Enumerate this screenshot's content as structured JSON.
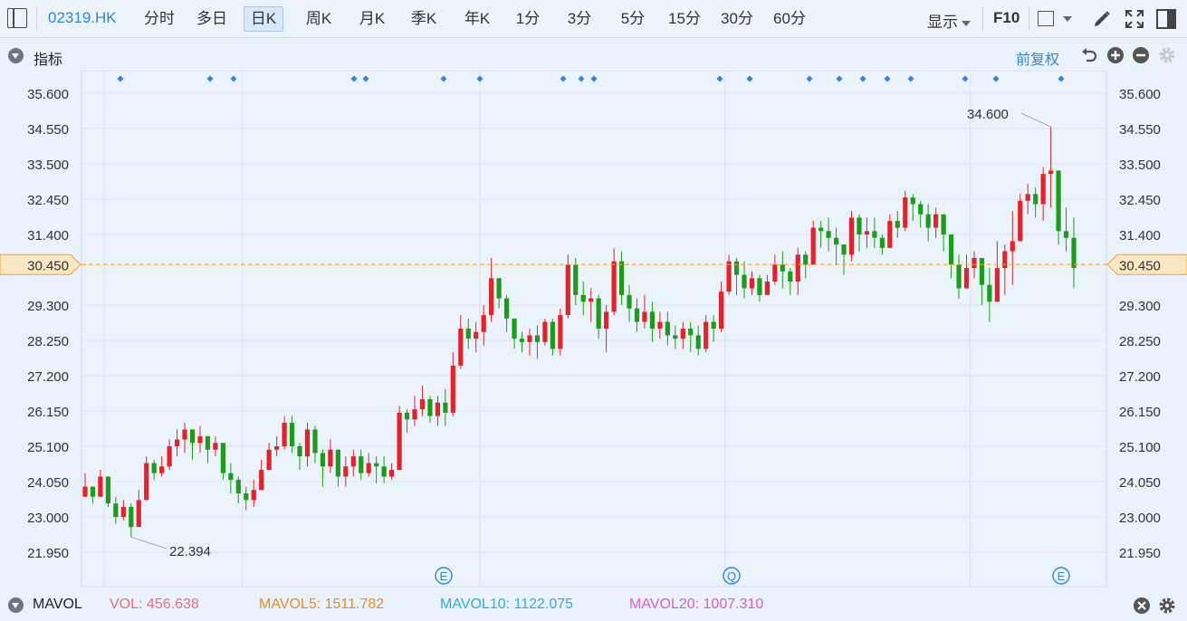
{
  "toolbar": {
    "symbol": "02319.HK",
    "periods": [
      "分时",
      "多日",
      "日K",
      "周K",
      "月K",
      "季K",
      "年K",
      "1分",
      "3分",
      "5分",
      "15分",
      "30分",
      "60分"
    ],
    "active_period": "日K",
    "display_label": "显示",
    "f10_label": "F10"
  },
  "indicator": {
    "title": "指标",
    "adjust_label": "前复权"
  },
  "price_axis": {
    "ticks": [
      "35.600",
      "34.550",
      "33.500",
      "32.450",
      "31.400",
      "30.450",
      "29.300",
      "28.250",
      "27.200",
      "26.150",
      "25.100",
      "24.050",
      "23.000",
      "21.950"
    ],
    "current_price": "30.450",
    "high_label": "34.600",
    "low_label": "22.394"
  },
  "event_markers": [
    "E",
    "Q",
    "E"
  ],
  "colors": {
    "up": "#e8202a",
    "down": "#1a9e1a",
    "price_line": "#f0a030",
    "grid": "#d6e4f0",
    "accent": "#2e86de"
  },
  "mavol": {
    "title": "MAVOL",
    "vol_label": "VOL:",
    "vol_value": "456.638",
    "vol_color": "#f06c75",
    "ma5_label": "MAVOL5:",
    "ma5_value": "1511.782",
    "ma5_color": "#ee8a22",
    "ma10_label": "MAVOL10:",
    "ma10_value": "1122.075",
    "ma10_color": "#2ab0d8",
    "ma20_label": "MAVOL20:",
    "ma20_value": "1007.310",
    "ma20_color": "#d461c8"
  },
  "chart_data": {
    "type": "candlestick",
    "ylim": [
      21.6,
      36.0
    ],
    "closes": [
      23.9,
      23.6,
      24.2,
      23.4,
      23.0,
      23.3,
      22.7,
      23.5,
      24.6,
      24.3,
      24.5,
      25.1,
      25.3,
      25.6,
      25.2,
      25.4,
      25.0,
      25.2,
      24.3,
      24.1,
      23.7,
      23.5,
      23.8,
      24.4,
      25.0,
      25.1,
      25.8,
      25.1,
      24.8,
      25.6,
      24.9,
      24.5,
      25.0,
      24.2,
      24.5,
      24.8,
      24.3,
      24.6,
      24.5,
      24.2,
      24.4,
      26.1,
      25.9,
      26.2,
      26.5,
      26.0,
      26.4,
      26.1,
      27.5,
      28.6,
      28.3,
      28.5,
      29.0,
      30.1,
      29.5,
      28.9,
      28.3,
      28.2,
      28.4,
      28.2,
      28.8,
      28.0,
      29.0,
      30.5,
      29.6,
      29.4,
      29.5,
      28.6,
      29.1,
      30.6,
      29.6,
      29.2,
      28.8,
      29.1,
      28.6,
      28.8,
      28.4,
      28.3,
      28.6,
      28.4,
      28.0,
      28.8,
      28.6,
      29.7,
      30.6,
      30.2,
      29.8,
      30.1,
      29.6,
      30.0,
      30.5,
      30.3,
      30.0,
      30.8,
      30.5,
      31.6,
      31.5,
      31.3,
      31.1,
      30.8,
      31.9,
      31.4,
      31.5,
      31.3,
      31.0,
      31.8,
      31.6,
      32.5,
      32.3,
      32.0,
      31.6,
      32.0,
      31.4,
      30.5,
      29.8,
      30.4,
      30.7,
      29.9,
      29.4,
      30.4,
      30.9,
      31.2,
      32.4,
      32.6,
      32.3,
      33.2,
      33.3,
      31.5,
      31.3,
      30.4
    ],
    "highs": [
      24.3,
      23.8,
      24.4,
      24.0,
      23.6,
      23.5,
      23.4,
      23.8,
      24.8,
      24.7,
      24.8,
      25.3,
      25.6,
      25.8,
      25.5,
      25.7,
      25.3,
      25.4,
      25.0,
      24.6,
      24.2,
      23.9,
      24.1,
      24.7,
      25.2,
      25.4,
      26.0,
      26.0,
      25.2,
      25.8,
      25.7,
      25.0,
      25.3,
      24.8,
      24.8,
      25.0,
      25.0,
      24.9,
      24.8,
      24.8,
      24.6,
      26.3,
      26.2,
      26.6,
      26.9,
      26.6,
      26.6,
      26.8,
      27.9,
      29.0,
      28.9,
      28.8,
      29.3,
      30.7,
      30.0,
      29.6,
      28.8,
      28.5,
      28.6,
      28.7,
      28.9,
      28.9,
      29.2,
      30.8,
      30.7,
      30.0,
      29.8,
      29.6,
      29.3,
      31.0,
      30.9,
      29.9,
      29.5,
      29.6,
      29.4,
      29.1,
      29.1,
      28.7,
      28.8,
      28.8,
      28.7,
      29.0,
      29.0,
      30.0,
      30.8,
      30.7,
      30.6,
      30.3,
      30.2,
      30.2,
      30.8,
      30.9,
      30.4,
      31.0,
      30.9,
      31.8,
      31.8,
      31.9,
      31.6,
      31.1,
      32.1,
      32.0,
      31.9,
      31.9,
      31.4,
      32.0,
      32.1,
      32.7,
      32.6,
      32.4,
      32.3,
      32.2,
      32.0,
      31.1,
      30.8,
      30.8,
      30.9,
      30.6,
      30.4,
      31.2,
      31.1,
      32.1,
      32.6,
      32.9,
      32.8,
      33.4,
      34.6,
      33.2,
      32.2,
      31.9
    ],
    "lows": [
      23.7,
      23.4,
      23.7,
      23.3,
      22.8,
      22.9,
      22.4,
      23.3,
      23.6,
      24.1,
      24.2,
      24.4,
      24.8,
      24.9,
      24.7,
      24.9,
      24.6,
      24.8,
      24.1,
      23.7,
      23.4,
      23.2,
      23.3,
      23.8,
      24.6,
      24.8,
      25.0,
      24.9,
      24.4,
      24.5,
      24.6,
      23.9,
      24.3,
      23.9,
      23.9,
      24.2,
      24.1,
      24.2,
      24.0,
      24.0,
      24.1,
      24.4,
      25.5,
      25.7,
      26.0,
      25.8,
      25.7,
      25.7,
      26.0,
      27.4,
      28.0,
      27.9,
      28.1,
      28.8,
      29.2,
      28.5,
      28.0,
      27.9,
      27.8,
      27.7,
      28.1,
      27.8,
      27.8,
      28.9,
      29.3,
      29.0,
      28.8,
      28.3,
      27.9,
      29.0,
      29.3,
      28.8,
      28.5,
      28.6,
      28.2,
      28.3,
      28.1,
      28.0,
      28.0,
      27.9,
      27.8,
      27.9,
      28.2,
      28.5,
      29.6,
      29.6,
      29.5,
      29.6,
      29.4,
      29.7,
      29.9,
      29.8,
      29.6,
      29.6,
      30.1,
      30.6,
      31.0,
      30.9,
      30.5,
      30.2,
      30.6,
      30.9,
      31.0,
      31.0,
      30.8,
      31.0,
      31.3,
      31.5,
      31.8,
      31.6,
      31.2,
      31.3,
      30.9,
      30.1,
      29.5,
      29.9,
      30.1,
      29.3,
      28.8,
      29.5,
      29.6,
      29.9,
      31.2,
      32.0,
      31.9,
      31.8,
      32.2,
      31.1,
      30.9,
      29.8
    ],
    "vline_after_index": [
      2,
      20,
      51,
      83,
      115
    ],
    "marker_x": [
      133,
      232,
      258,
      391,
      404,
      490,
      530,
      622,
      642,
      656,
      795,
      828,
      894,
      927,
      953,
      980,
      1006,
      1066,
      1100,
      1172
    ]
  }
}
